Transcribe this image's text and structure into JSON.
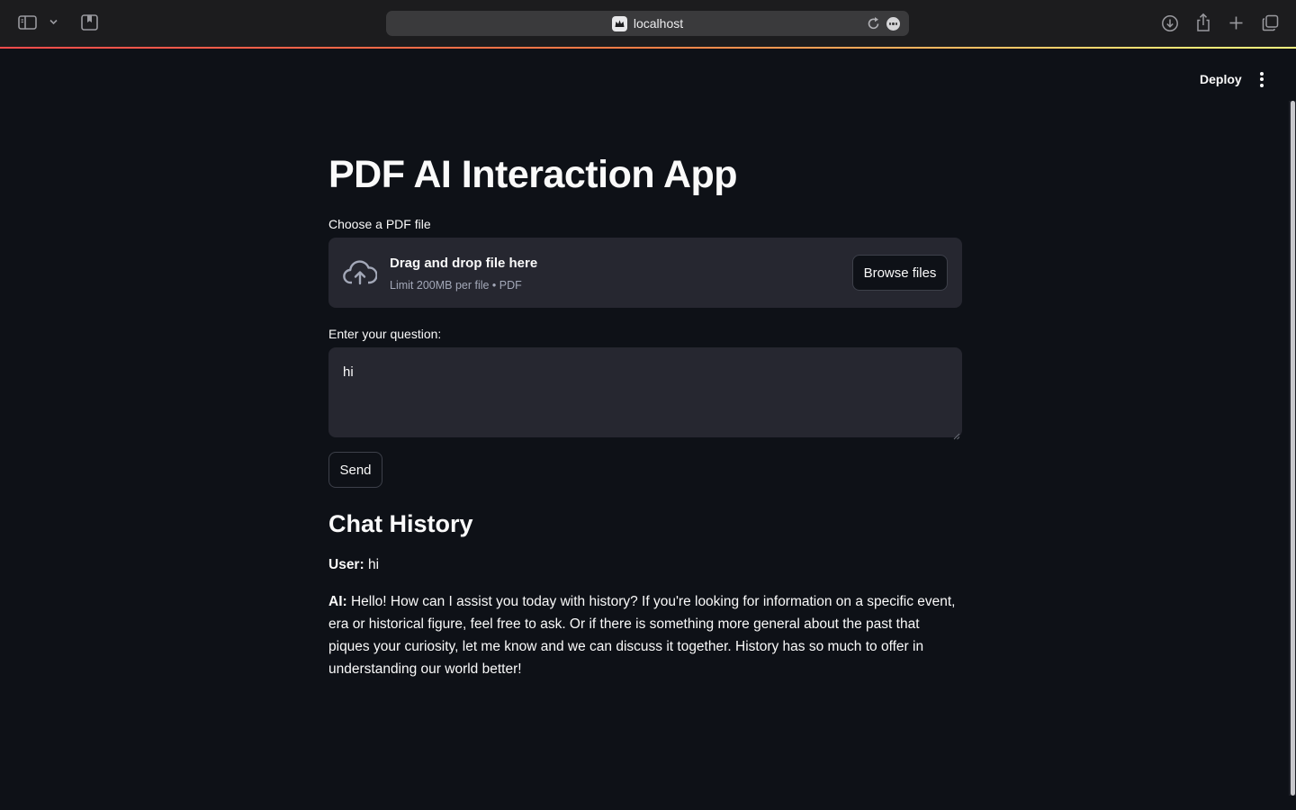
{
  "browser": {
    "address": "localhost",
    "icons": [
      "sidebar-toggle-icon",
      "chevron-down-icon",
      "bookmark-icon",
      "site-icon",
      "reload-icon",
      "more-icon",
      "download-icon",
      "share-icon",
      "new-tab-icon",
      "tab-overview-icon"
    ]
  },
  "header": {
    "deploy_label": "Deploy",
    "menu_icon": "vertical-ellipsis-icon"
  },
  "app": {
    "title": "PDF AI Interaction App",
    "uploader": {
      "label": "Choose a PDF file",
      "title": "Drag and drop file here",
      "hint": "Limit 200MB per file • PDF",
      "browse_label": "Browse files",
      "icon": "cloud-upload-icon"
    },
    "question": {
      "label": "Enter your question:",
      "value": "hi"
    },
    "send_label": "Send",
    "history": {
      "heading": "Chat History",
      "messages": [
        {
          "speaker": "User:",
          "text": "hi"
        },
        {
          "speaker": "AI:",
          "text": "Hello! How can I assist you today with history? If you're looking for information on a specific event, era or historical figure, feel free to ask. Or if there is something more general about the past that piques your curiosity, let me know and we can discuss it together. History has so much to offer in understanding our world better!"
        }
      ]
    }
  },
  "colors": {
    "background": "#0e1117",
    "widget_bg": "#262730",
    "text": "#fafafa",
    "muted_text": "#a3a8b8",
    "accent_gradient": [
      "#ff4b4b",
      "#fffd80"
    ]
  }
}
